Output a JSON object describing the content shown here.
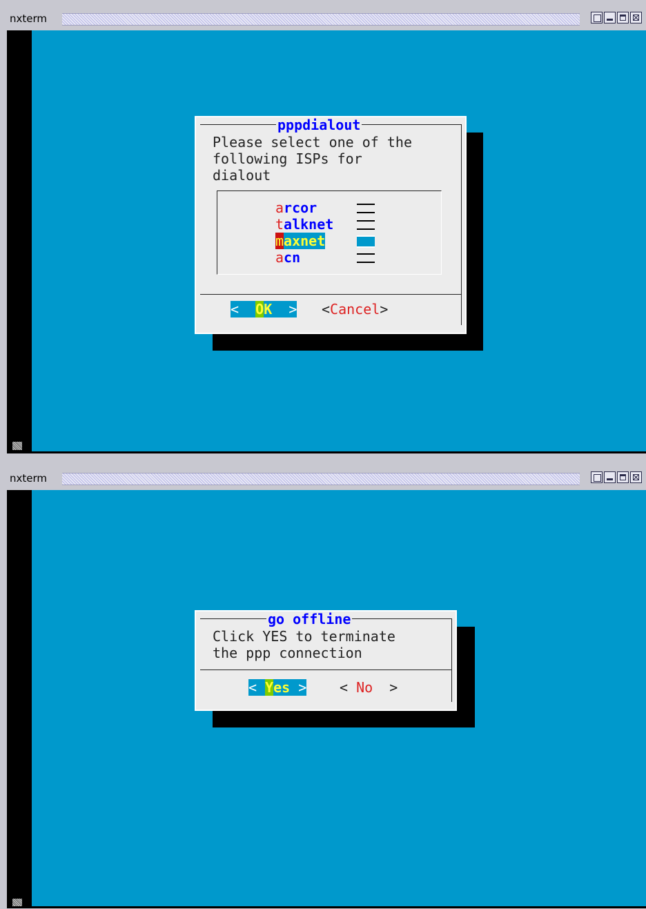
{
  "windows": [
    {
      "title": "nxterm",
      "dialog": {
        "title": "pppdialout",
        "message": "Please select one of the\nfollowing ISPs for\ndialout",
        "items": [
          {
            "hotkey": "a",
            "rest": "rcor",
            "mark": "==",
            "selected": false
          },
          {
            "hotkey": "t",
            "rest": "alknet",
            "mark": "==",
            "selected": false
          },
          {
            "hotkey": "m",
            "rest": "axnet",
            "mark": "==",
            "selected": true
          },
          {
            "hotkey": "a",
            "rest": "cn",
            "mark": "==",
            "selected": false
          }
        ],
        "ok_button": {
          "left": "<",
          "hotkey": "O",
          "rest": "K",
          "right": ">"
        },
        "cancel_button": {
          "left": "<",
          "hotkey": "C",
          "rest": "ancel",
          "right": ">"
        }
      }
    },
    {
      "title": "nxterm",
      "dialog": {
        "title": "go offline",
        "message": "Click YES to terminate\nthe ppp connection",
        "yes_button": {
          "left": "<",
          "hotkey": "Y",
          "rest": "es",
          "right": ">"
        },
        "no_button": {
          "left": "<",
          "hotkey": "N",
          "rest": "o",
          "right": ">"
        }
      }
    }
  ],
  "colors": {
    "screen_bg": "#0099cc",
    "dialog_bg": "#ececec",
    "title_fg": "#0000ff",
    "hotkey_fg": "#dd2222",
    "highlight_fg": "#ffff33",
    "button_hotkey_bg": "#7ecb00"
  },
  "icons": [
    "window-menu-icon",
    "minimize-icon",
    "maximize-icon",
    "close-icon",
    "resize-grip-icon"
  ]
}
